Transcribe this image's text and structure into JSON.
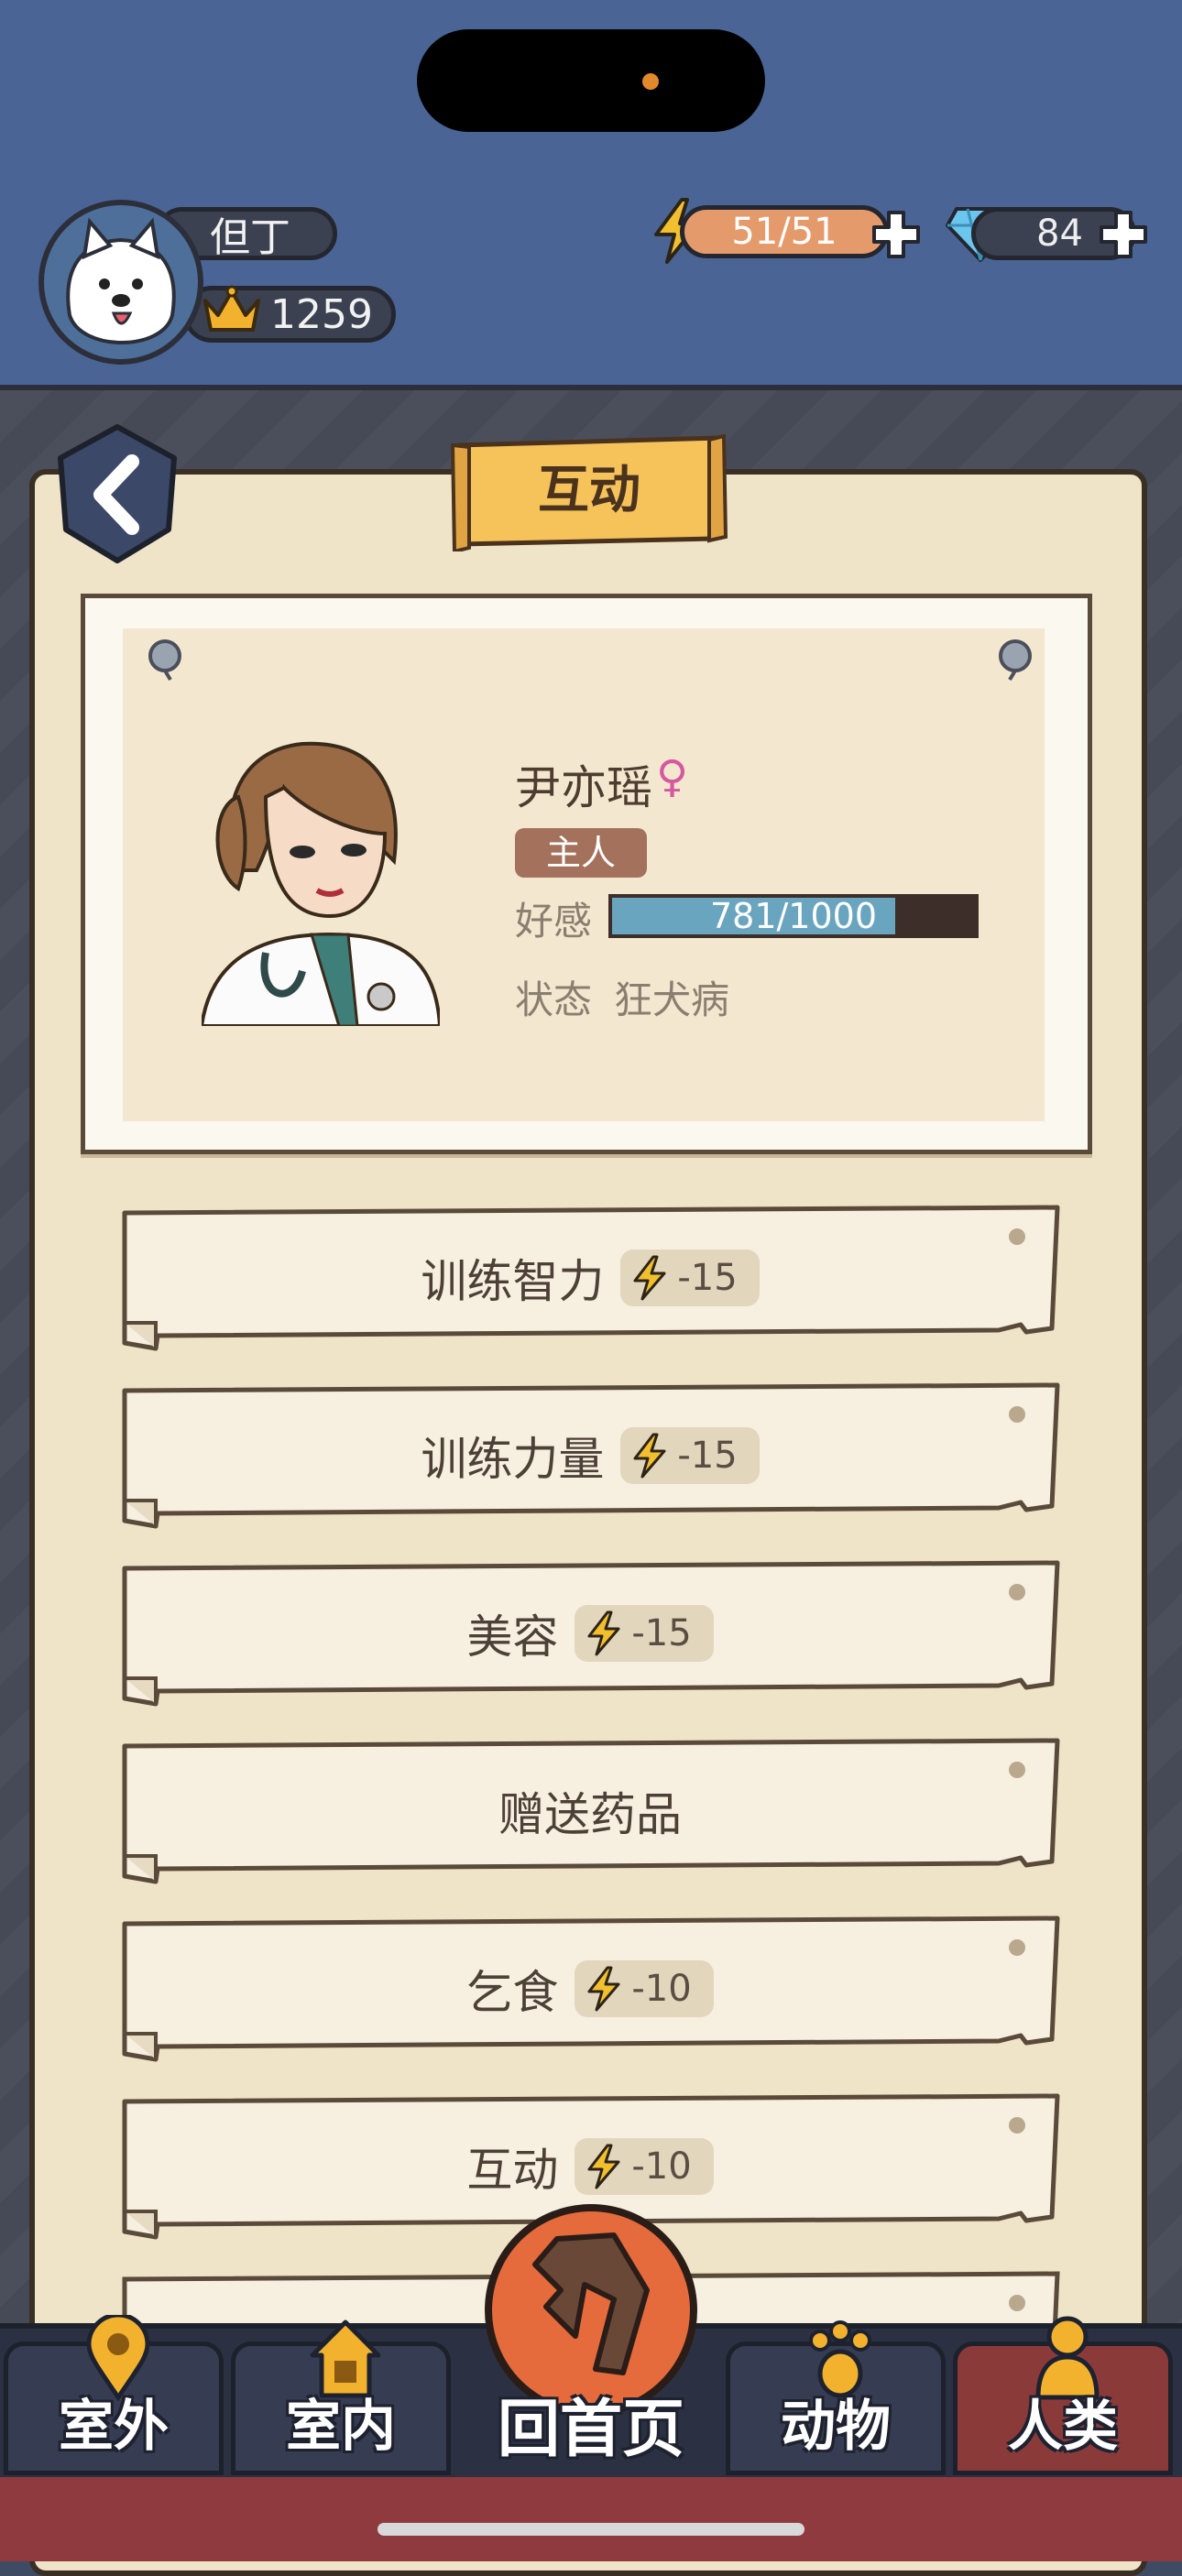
{
  "player": {
    "name": "但丁",
    "crowns": "1259"
  },
  "resources": {
    "energy": "51/51",
    "gems": "84"
  },
  "page": {
    "title": "互动"
  },
  "character": {
    "name": "尹亦瑶",
    "gender_symbol": "♀",
    "role": "主人",
    "favor_label": "好感",
    "favor_text": "781/1000",
    "favor_value": 781,
    "favor_max": 1000,
    "status_label": "状态",
    "status_value": "狂犬病"
  },
  "actions": [
    {
      "label": "训练智力",
      "cost": "-15"
    },
    {
      "label": "训练力量",
      "cost": "-15"
    },
    {
      "label": "美容",
      "cost": "-15"
    },
    {
      "label": "赠送药品",
      "cost": ""
    },
    {
      "label": "乞食",
      "cost": "-10"
    },
    {
      "label": "互动",
      "cost": "-10"
    }
  ],
  "nav": {
    "outdoor": "室外",
    "indoor": "室内",
    "home": "回首页",
    "animals": "动物",
    "humans": "人类"
  },
  "colors": {
    "header_blue": "#4a6595",
    "parchment": "#efe3c8",
    "favor_fill": "#6aa5bf",
    "energy_orange": "#e59a6c",
    "active_tab": "#8b3a3a"
  }
}
